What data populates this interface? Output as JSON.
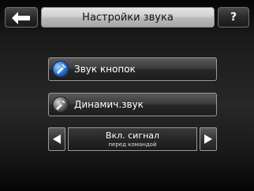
{
  "header": {
    "title": "Настройки звука",
    "help_label": "?"
  },
  "options": [
    {
      "label": "Звук кнопок",
      "icon": "button-sound-icon"
    },
    {
      "label": "Динамич.звук",
      "icon": "dynamic-sound-icon"
    }
  ],
  "selector": {
    "value": "Вкл. сигнал",
    "subtitle": "перед командой"
  }
}
